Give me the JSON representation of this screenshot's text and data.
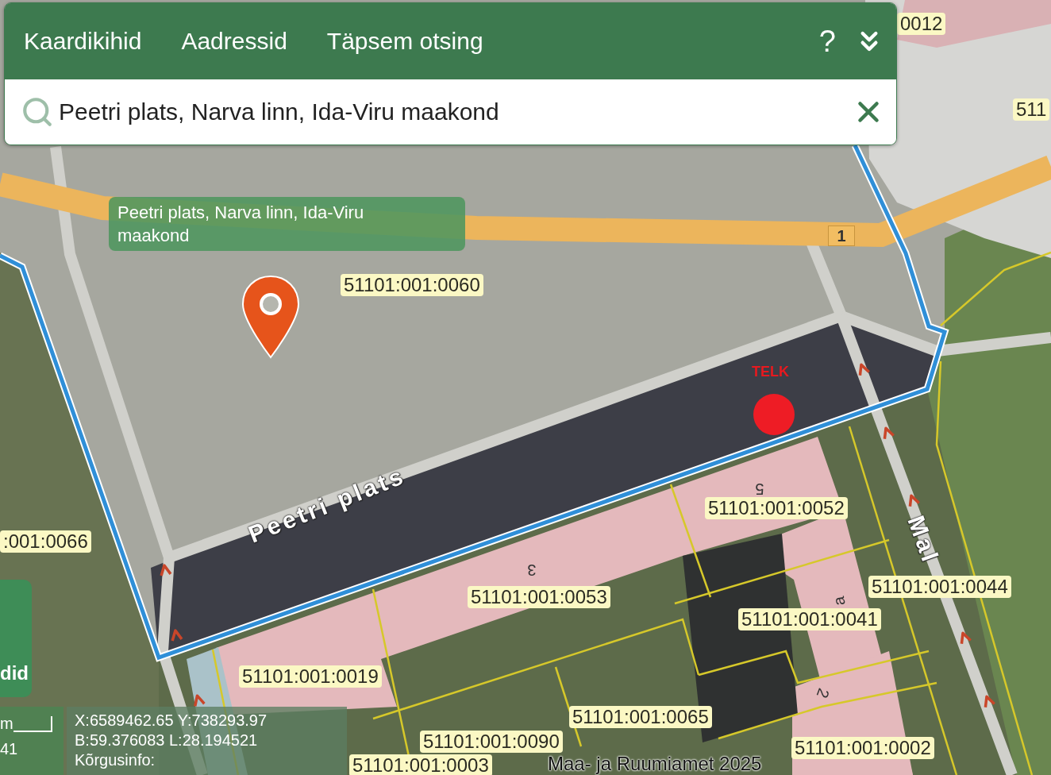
{
  "header": {
    "tabs": [
      {
        "label": "Kaardikihid"
      },
      {
        "label": "Aadressid"
      },
      {
        "label": "Täpsem otsing"
      }
    ],
    "help_label": "?"
  },
  "search": {
    "value": "Peetri plats, Narva linn, Ida-Viru maakond"
  },
  "map": {
    "tooltip": "Peetri plats, Narva linn, Ida-Viru maakond",
    "parcel_labels": [
      "0012",
      "511",
      "51101:001:0060",
      ":001:0066",
      "51101:001:0052",
      "51101:001:0053",
      "51101:001:0044",
      "51101:001:0041",
      "51101:001:0019",
      "51101:001:0065",
      "51101:001:0090",
      "51101:001:0002",
      "51101:001:0003"
    ],
    "street_labels": [
      "Peetri plats",
      "Mal"
    ],
    "house_numbers": [
      "5",
      "3",
      "a",
      "2"
    ],
    "road_number": "1",
    "point_label": "TELK",
    "attribution": "Maa- ja Ruumiamet 2025"
  },
  "layers_panel": {
    "label": "did"
  },
  "scale": {
    "unit": "m",
    "value": "41"
  },
  "coordinates": {
    "lines": [
      "X:6589462.65 Y:738293.97",
      "B:59.376083 L:28.194521",
      "Kõrgusinfo:"
    ]
  }
}
